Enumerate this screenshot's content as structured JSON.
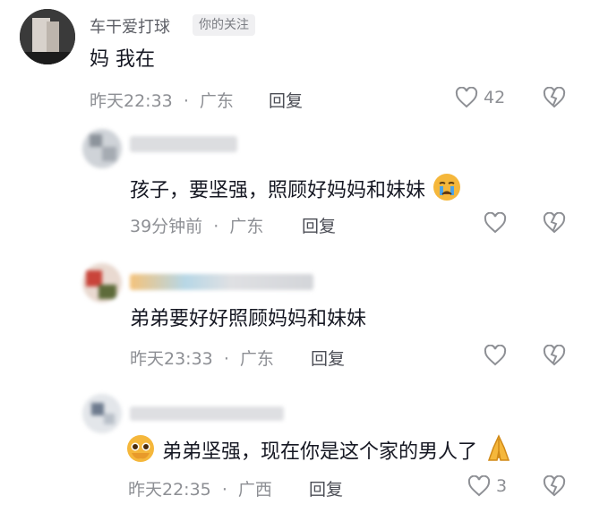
{
  "comments": [
    {
      "username": "车干爱打球",
      "tag": "你的关注",
      "text": "妈 我在",
      "time": "昨天22:33",
      "location": "广东",
      "reply_label": "回复",
      "like_count": "42"
    },
    {
      "username": "",
      "text": "孩子，要坚强，照顾好妈妈和妹妹",
      "emoji": "crying-face",
      "time": "39分钟前",
      "location": "广东",
      "reply_label": "回复",
      "like_count": ""
    },
    {
      "username": "",
      "text": "弟弟要好好照顾妈妈和妹妹",
      "time": "昨天23:33",
      "location": "广东",
      "reply_label": "回复",
      "like_count": ""
    },
    {
      "username": "",
      "text": "弟弟坚强，现在你是这个家的男人了",
      "emoji_before": "pleading-face",
      "emoji_after": "folded-hands",
      "time": "昨天22:35",
      "location": "广西",
      "reply_label": "回复",
      "like_count": "3"
    }
  ],
  "separator": "·",
  "colors": {
    "meta": "#8d8f94",
    "text": "#161823",
    "accent_emoji": "#f5b73b"
  }
}
